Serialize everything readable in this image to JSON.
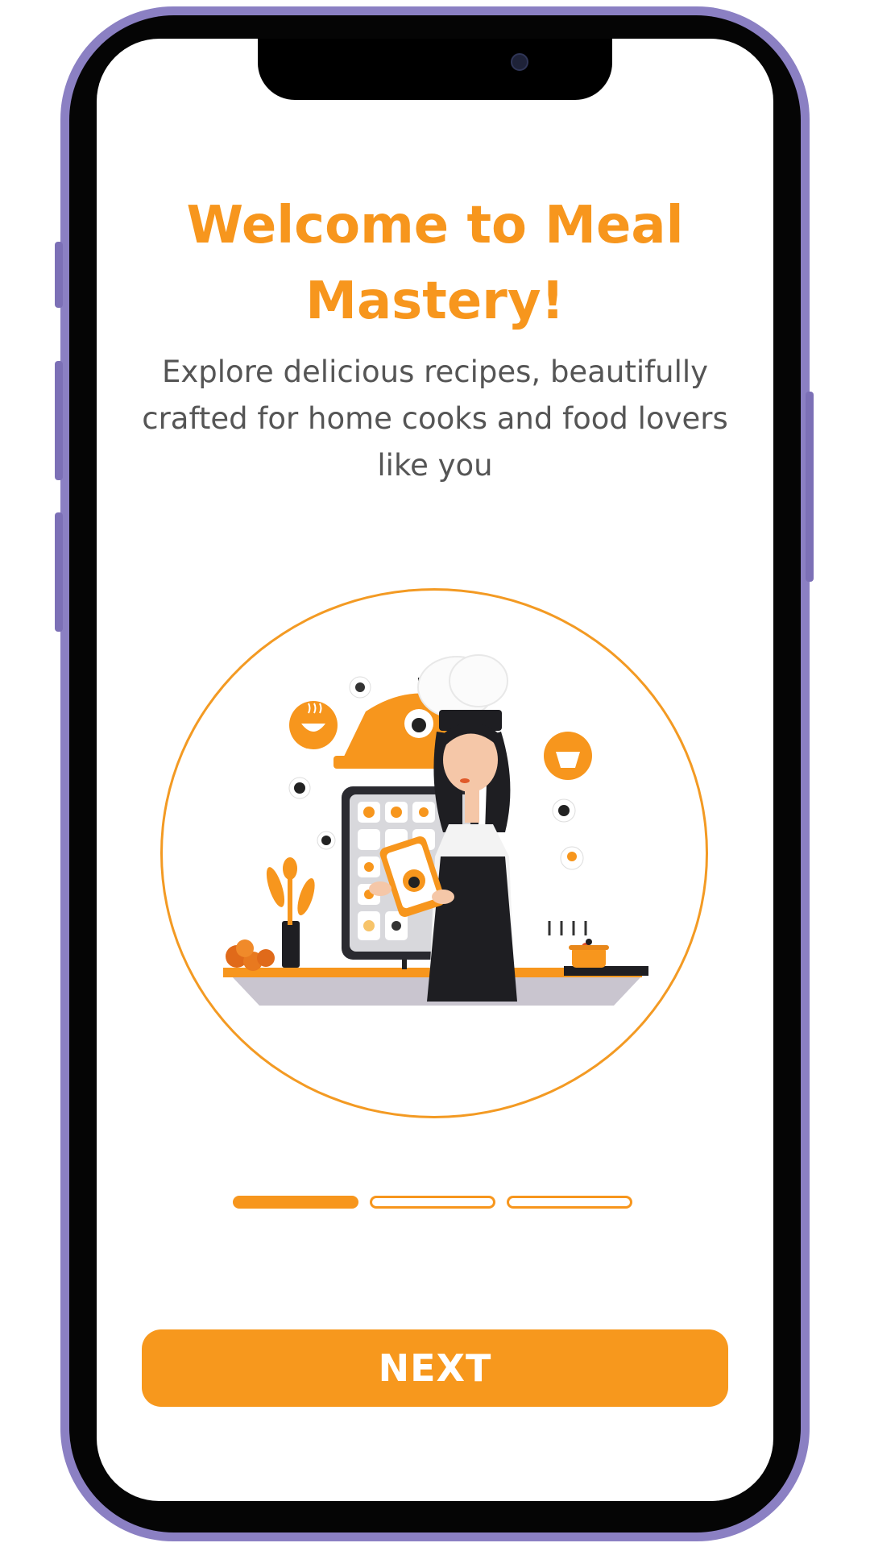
{
  "onboarding": {
    "title": "Welcome to Meal Mastery!",
    "subtitle": "Explore delicious recipes, beautifully crafted for home cooks and food lovers like you",
    "illustration": "chef-with-tablet-kitchen-illustration",
    "page_indicator": {
      "current": 1,
      "total": 3
    },
    "next_label": "NEXT"
  },
  "colors": {
    "accent": "#f7961d",
    "text": "#555555",
    "frame": "#8b80c3"
  }
}
